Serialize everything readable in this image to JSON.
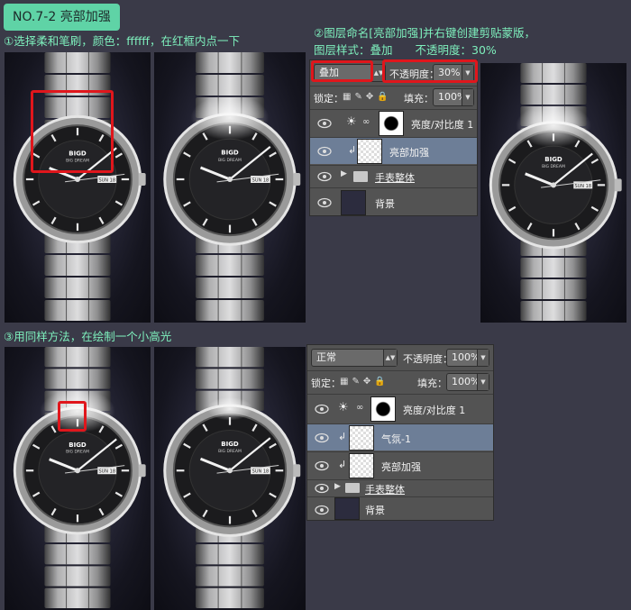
{
  "title": "NO.7-2 亮部加强",
  "steps": {
    "step1": "①选择柔和笔刷，颜色：ffffff，在红框内点一下",
    "step2_line1": "②图层命名[亮部加强]并右键创建剪贴蒙版，",
    "step2_line2": "图层样式：叠加　　不透明度：30%",
    "step3": "③用同样方法，在绘制一个小高光"
  },
  "watch": {
    "brand": "BIGD",
    "brand_sub": "BIG DREAM",
    "date_window": "SUN 18"
  },
  "panel1": {
    "blend_mode": "叠加",
    "opacity_label": "不透明度：",
    "opacity_value": "30%",
    "lock_label": "锁定：",
    "fill_label": "填充：",
    "fill_value": "100%",
    "layers": [
      {
        "name": "亮度/对比度 1",
        "type": "adjustment",
        "selected": false
      },
      {
        "name": "亮部加强",
        "type": "clipped",
        "selected": true
      },
      {
        "name": "手表整体",
        "type": "group",
        "selected": false
      },
      {
        "name": "背景",
        "type": "background",
        "selected": false
      }
    ]
  },
  "panel2": {
    "blend_mode": "正常",
    "opacity_label": "不透明度：",
    "opacity_value": "100%",
    "lock_label": "锁定：",
    "fill_label": "填充：",
    "fill_value": "100%",
    "layers": [
      {
        "name": "亮度/对比度 1",
        "type": "adjustment",
        "selected": false
      },
      {
        "name": "气氛-1",
        "type": "clipped",
        "selected": true
      },
      {
        "name": "亮部加强",
        "type": "clipped",
        "selected": false
      },
      {
        "name": "手表整体",
        "type": "group",
        "selected": false
      },
      {
        "name": "背景",
        "type": "background",
        "selected": false
      }
    ]
  },
  "colors": {
    "accent_green": "#7ef0bd",
    "badge_green": "#5fd3a6",
    "highlight_red": "#e0161c",
    "layer_selected": "#6d7e97"
  }
}
